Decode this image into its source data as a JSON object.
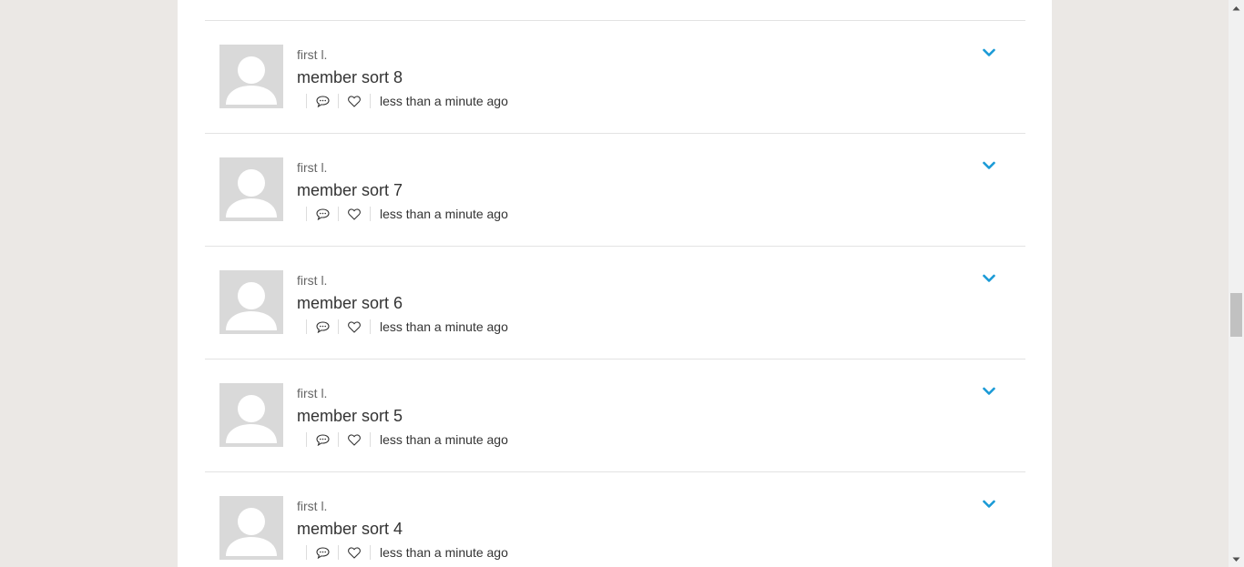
{
  "feed": {
    "items": [
      {
        "author": "first l.",
        "title": "member sort 8",
        "time": "less than a minute ago"
      },
      {
        "author": "first l.",
        "title": "member sort 7",
        "time": "less than a minute ago"
      },
      {
        "author": "first l.",
        "title": "member sort 6",
        "time": "less than a minute ago"
      },
      {
        "author": "first l.",
        "title": "member sort 5",
        "time": "less than a minute ago"
      },
      {
        "author": "first l.",
        "title": "member sort 4",
        "time": "less than a minute ago"
      }
    ]
  },
  "icons": {
    "comment": "comment-icon",
    "like": "heart-icon",
    "menu": "chevron-down-icon",
    "avatar": "user-placeholder-icon"
  },
  "colors": {
    "accent": "#1a9ad6",
    "page_background": "#ebe8e5",
    "panel_background": "#ffffff",
    "avatar_background": "#d9d9d9"
  },
  "scrollbar": {
    "position_fraction": 0.55
  }
}
